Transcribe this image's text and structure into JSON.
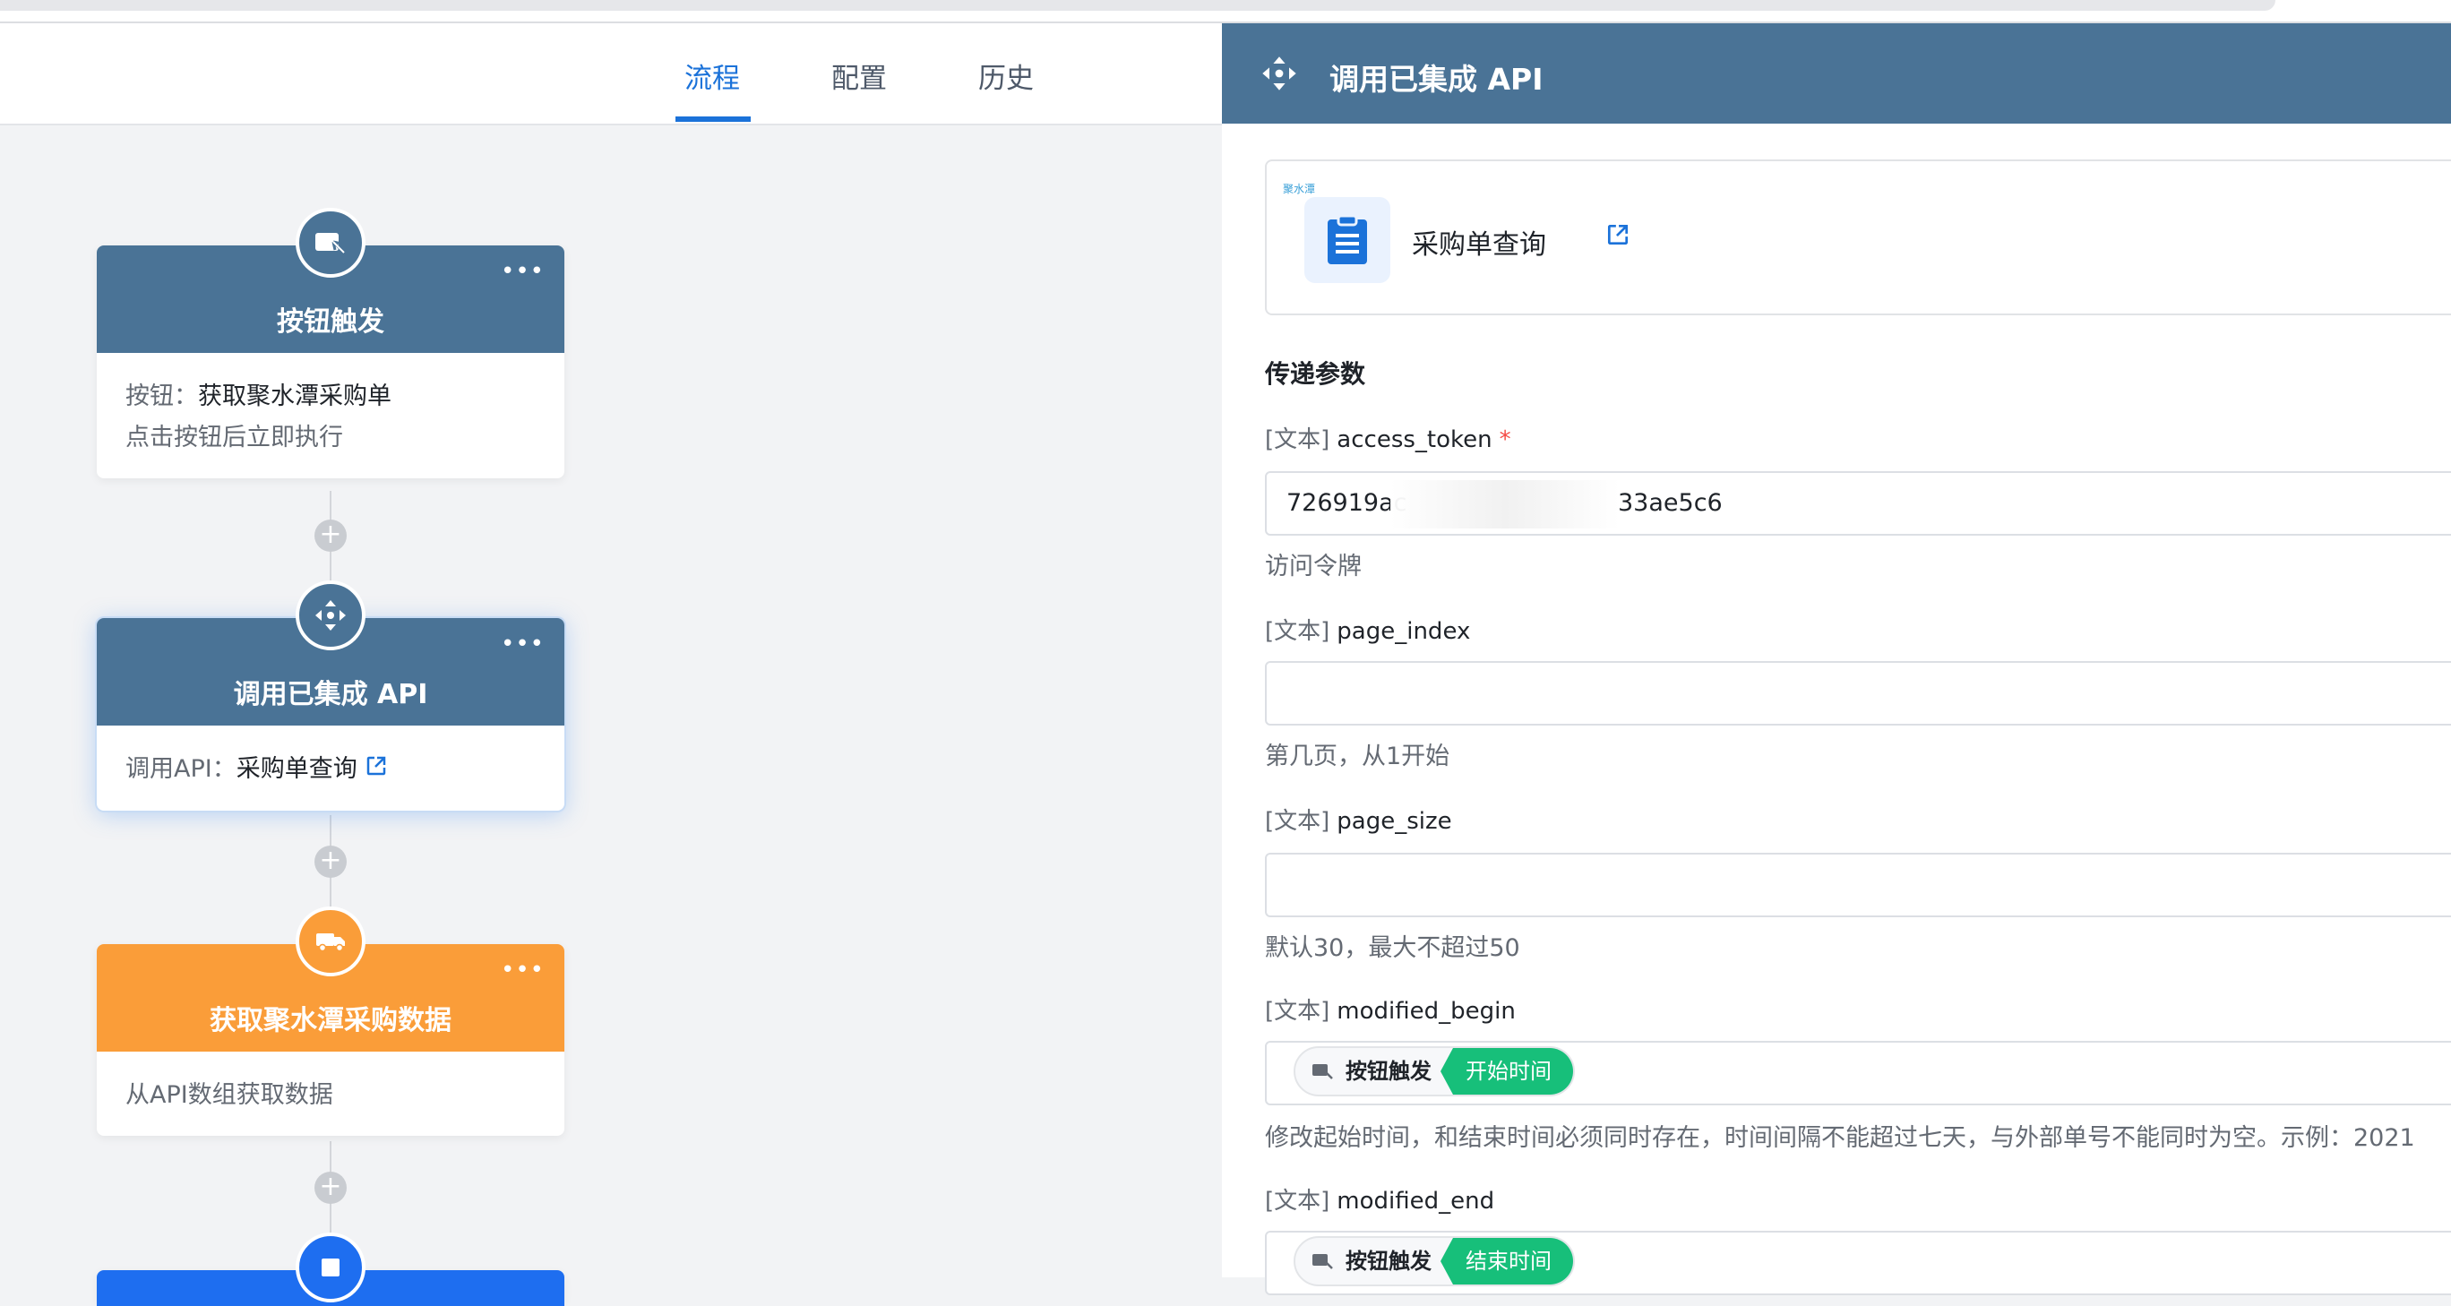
{
  "tabs": [
    {
      "label": "流程",
      "active": true
    },
    {
      "label": "配置",
      "active": false
    },
    {
      "label": "历史",
      "active": false
    }
  ],
  "nodes": [
    {
      "title": "按钮触发",
      "icon": "button-trigger-icon",
      "menu": "•••",
      "line1_label": "按钮：",
      "line1_value": "获取聚水潭采购单",
      "line2": "点击按钮后立即执行"
    },
    {
      "title": "调用已集成 API",
      "icon": "api-icon",
      "menu": "•••",
      "line1_label": "调用API：",
      "line1_value": "采购单查询"
    },
    {
      "title": "获取聚水潭采购数据",
      "icon": "truck-icon",
      "menu": "•••",
      "line1": "从API数组获取数据"
    }
  ],
  "plus_symbol": "+",
  "panel": {
    "title": "调用已集成 API",
    "api_brand": "聚水潭",
    "api_name": "采购单查询",
    "section_title": "传递参数",
    "fields": [
      {
        "type": "[文本]",
        "key": "access_token",
        "required_mark": "*",
        "value_prefix": "726919ac",
        "value_suffix": "33ae5c6",
        "help": "访问令牌"
      },
      {
        "type": "[文本]",
        "key": "page_index",
        "value": "",
        "help": "第几页，从1开始"
      },
      {
        "type": "[文本]",
        "key": "page_size",
        "value": "",
        "help": "默认30，最大不超过50"
      },
      {
        "type": "[文本]",
        "key": "modified_begin",
        "chip_source": "按钮触发",
        "chip_field": "开始时间",
        "help": "修改起始时间，和结束时间必须同时存在，时间间隔不能超过七天，与外部单号不能同时为空。示例：2021"
      },
      {
        "type": "[文本]",
        "key": "modified_end",
        "chip_source": "按钮触发",
        "chip_field": "结束时间"
      }
    ]
  },
  "colors": {
    "header_blue": "#4a7396",
    "accent": "#1b72d9",
    "orange": "#fa9d39",
    "green": "#17bf7a"
  }
}
